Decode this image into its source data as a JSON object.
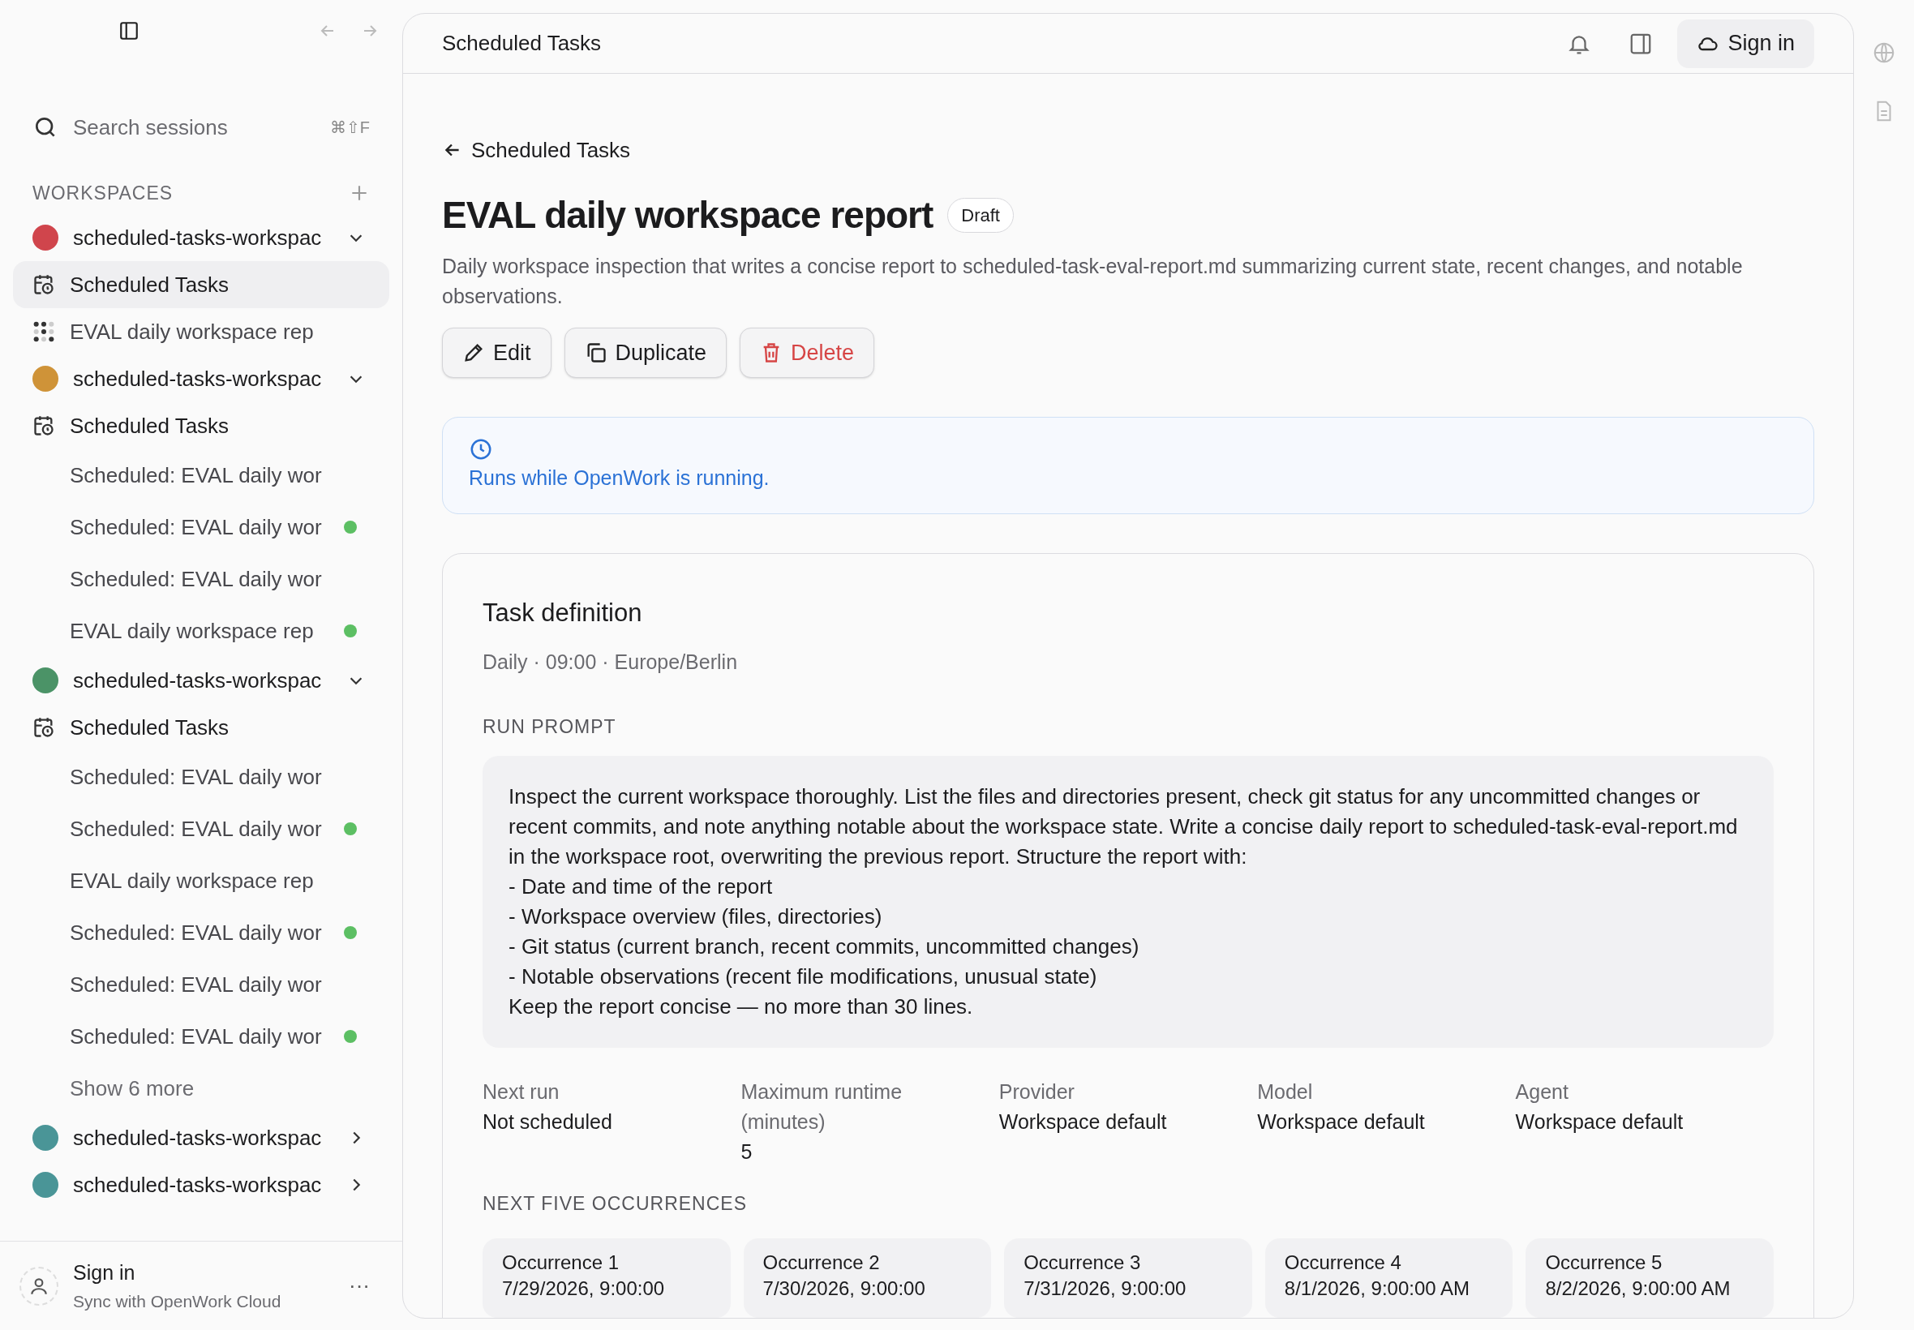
{
  "sidebar": {
    "search": {
      "placeholder": "Search sessions",
      "shortcut": "⌘⇧F"
    },
    "section_label": "WORKSPACES",
    "workspaces": [
      {
        "name": "scheduled-tasks-workspac",
        "color": "#d0454c",
        "expanded": true,
        "items": [
          {
            "kind": "tasks",
            "label": "Scheduled Tasks",
            "selected": true,
            "active": false
          },
          {
            "kind": "loading",
            "label": "EVAL daily workspace rep",
            "selected": false,
            "active": false
          }
        ]
      },
      {
        "name": "scheduled-tasks-workspac",
        "color": "#cf9338",
        "expanded": true,
        "items": [
          {
            "kind": "tasks",
            "label": "Scheduled Tasks",
            "selected": false,
            "active": false
          },
          {
            "kind": "session",
            "label": "Scheduled: EVAL daily wor",
            "selected": false,
            "active": false
          },
          {
            "kind": "session",
            "label": "Scheduled: EVAL daily wor",
            "selected": false,
            "active": true
          },
          {
            "kind": "session",
            "label": "Scheduled: EVAL daily wor",
            "selected": false,
            "active": false
          },
          {
            "kind": "session",
            "label": "EVAL daily workspace rep",
            "selected": false,
            "active": true
          }
        ]
      },
      {
        "name": "scheduled-tasks-workspac",
        "color": "#4b9367",
        "expanded": true,
        "items": [
          {
            "kind": "tasks",
            "label": "Scheduled Tasks",
            "selected": false,
            "active": false
          },
          {
            "kind": "session",
            "label": "Scheduled: EVAL daily wor",
            "selected": false,
            "active": false
          },
          {
            "kind": "session",
            "label": "Scheduled: EVAL daily wor",
            "selected": false,
            "active": true
          },
          {
            "kind": "session",
            "label": "EVAL daily workspace rep",
            "selected": false,
            "active": false
          },
          {
            "kind": "session",
            "label": "Scheduled: EVAL daily wor",
            "selected": false,
            "active": true
          },
          {
            "kind": "session",
            "label": "Scheduled: EVAL daily wor",
            "selected": false,
            "active": false
          },
          {
            "kind": "session",
            "label": "Scheduled: EVAL daily wor",
            "selected": false,
            "active": true
          },
          {
            "kind": "more",
            "label": "Show 6 more",
            "selected": false,
            "active": false
          }
        ]
      },
      {
        "name": "scheduled-tasks-workspac",
        "color": "#4a9597",
        "expanded": false
      },
      {
        "name": "scheduled-tasks-workspac",
        "color": "#4a9597",
        "expanded": false
      }
    ],
    "footer": {
      "title": "Sign in",
      "subtitle": "Sync with OpenWork Cloud",
      "menu": "···"
    }
  },
  "header": {
    "title": "Scheduled Tasks",
    "sign_in": "Sign in"
  },
  "page": {
    "back": "Scheduled Tasks",
    "title": "EVAL daily workspace report",
    "badge": "Draft",
    "description": "Daily workspace inspection that writes a concise report to scheduled-task-eval-report.md summarizing current state, recent changes, and notable observations.",
    "buttons": [
      {
        "kind": "edit",
        "label": "Edit"
      },
      {
        "kind": "duplicate",
        "label": "Duplicate"
      },
      {
        "kind": "delete",
        "label": "Delete"
      }
    ],
    "notice": "Runs while OpenWork is running.",
    "card": {
      "title": "Task definition",
      "schedule": "Daily · 09:00 · Europe/Berlin",
      "prompt_label": "RUN PROMPT",
      "prompt": "Inspect the current workspace thoroughly. List the files and directories present, check git status for any uncommitted changes or recent commits, and note anything notable about the workspace state. Write a concise daily report to scheduled-task-eval-report.md in the workspace root, overwriting the previous report. Structure the report with:\n- Date and time of the report\n- Workspace overview (files, directories)\n- Git status (current branch, recent commits, uncommitted changes)\n- Notable observations (recent file modifications, unusual state)\nKeep the report concise — no more than 30 lines.",
      "fields": [
        {
          "label": "Next run",
          "value": "Not scheduled"
        },
        {
          "label": "Maximum runtime (minutes)",
          "value": "5"
        },
        {
          "label": "Provider",
          "value": "Workspace default"
        },
        {
          "label": "Model",
          "value": "Workspace default"
        },
        {
          "label": "Agent",
          "value": "Workspace default"
        }
      ],
      "occurrences_label": "NEXT FIVE OCCURRENCES",
      "occurrences": [
        {
          "label": "Occurrence 1",
          "value": "7/29/2026, 9:00:00"
        },
        {
          "label": "Occurrence 2",
          "value": "7/30/2026, 9:00:00"
        },
        {
          "label": "Occurrence 3",
          "value": "7/31/2026, 9:00:00"
        },
        {
          "label": "Occurrence 4",
          "value": "8/1/2026, 9:00:00 AM"
        },
        {
          "label": "Occurrence 5",
          "value": "8/2/2026, 9:00:00 AM"
        }
      ]
    }
  }
}
